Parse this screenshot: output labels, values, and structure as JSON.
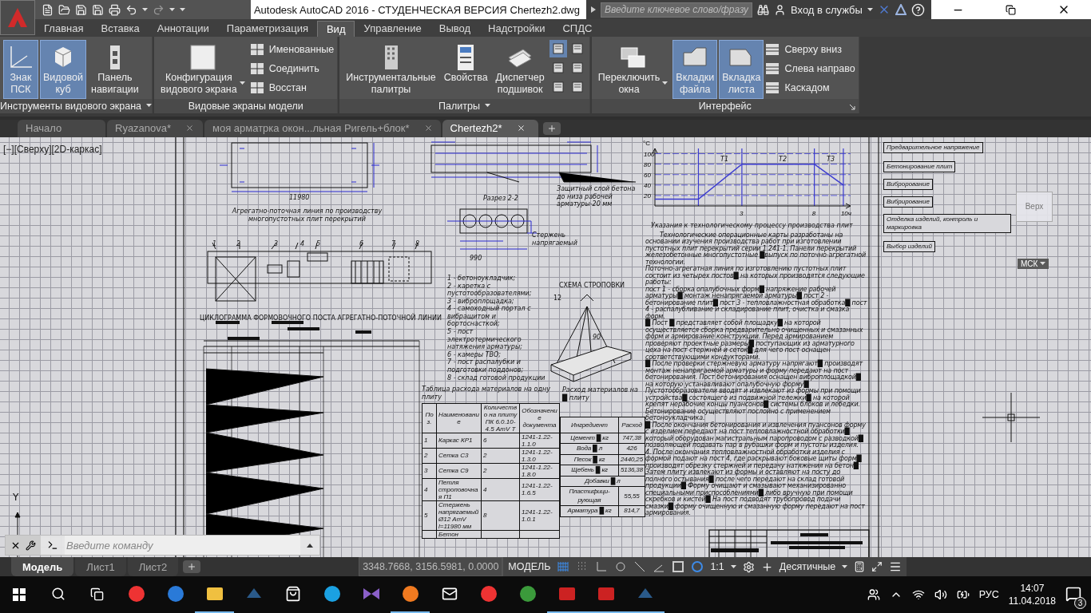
{
  "window": {
    "title": "Autodesk AutoCAD 2016 - СТУДЕНЧЕСКАЯ ВЕРСИЯ",
    "file": "Chertezh2.dwg",
    "search_placeholder": "Введите ключевое слово/фразу",
    "signin": "Вход в службы"
  },
  "ribbon_tabs": [
    {
      "label": "Главная",
      "selected": false
    },
    {
      "label": "Вставка",
      "selected": false
    },
    {
      "label": "Аннотации",
      "selected": false
    },
    {
      "label": "Параметризация",
      "selected": false
    },
    {
      "label": "Вид",
      "selected": true
    },
    {
      "label": "Управление",
      "selected": false
    },
    {
      "label": "Вывод",
      "selected": false
    },
    {
      "label": "Надстройки",
      "selected": false
    },
    {
      "label": "СПДС",
      "selected": false
    }
  ],
  "panels": [
    {
      "title": "Инструменты видового экрана",
      "menu": true,
      "items": [
        {
          "kind": "large",
          "label": "Знак\nПСК",
          "on": true
        },
        {
          "kind": "large",
          "label": "Видовой\nкуб",
          "on": true
        },
        {
          "kind": "large",
          "label": "Панель\nнавигации",
          "on": false
        }
      ]
    },
    {
      "title": "Видовые экраны модели",
      "menu": false,
      "items": [
        {
          "kind": "large",
          "label": "Конфигурация\nвидового экрана",
          "on": false,
          "dropdown": true
        },
        {
          "kind": "small",
          "label": "Именованные"
        },
        {
          "kind": "small",
          "label": "Соединить"
        },
        {
          "kind": "small",
          "label": "Восстан"
        }
      ]
    },
    {
      "title": "Палитры",
      "menu": true,
      "items": [
        {
          "kind": "large",
          "label": "Инструментальные\nпалитры",
          "on": false
        },
        {
          "kind": "large",
          "label": "Свойства",
          "on": false
        },
        {
          "kind": "large",
          "label": "Диспетчер\nподшивок",
          "on": false
        },
        {
          "kind": "icon",
          "on": true
        },
        {
          "kind": "icon",
          "on": false
        },
        {
          "kind": "icon",
          "on": false
        },
        {
          "kind": "icon",
          "on": false
        },
        {
          "kind": "icon",
          "on": false
        },
        {
          "kind": "icon",
          "on": false
        }
      ]
    },
    {
      "title": "Интерфейс",
      "menu": false,
      "launcher": true,
      "items": [
        {
          "kind": "large",
          "label": "Переключить\nокна",
          "on": false,
          "dropdown": true
        },
        {
          "kind": "large",
          "label": "Вкладки\nфайла",
          "on": true
        },
        {
          "kind": "large",
          "label": "Вкладка\nлиста",
          "on": true
        },
        {
          "kind": "small",
          "label": "Сверху вниз"
        },
        {
          "kind": "small",
          "label": "Слева направо"
        },
        {
          "kind": "small",
          "label": "Каскадом"
        }
      ]
    }
  ],
  "doc_tabs": [
    {
      "label": "Начало",
      "selected": false,
      "closable": false
    },
    {
      "label": "Ryazanova*",
      "selected": false,
      "closable": true
    },
    {
      "label": "моя арматрка окон...льная Ригель+блок*",
      "selected": false,
      "closable": true
    },
    {
      "label": "Chertezh2*",
      "selected": true,
      "closable": true
    }
  ],
  "viewport_label": "[−][Сверху][2D-каркас]",
  "annotations": [
    "Агрегатно-поточная линия по производству многопустотных плит перекрытий",
    "ЦИКЛОГРАММА ФОРМОВОЧНОГО ПОСТА АГРЕГАТНО-ПОТОЧНОЙ ЛИНИИ",
    "Разрез 2-2",
    "Защитный слой бетона до низа рабочей арматуры-20 мм",
    "Стержень напрягаемый",
    "СХЕМА СТРОПОВКИ",
    "12",
    "90",
    "11980",
    "990",
    "Указания к технологическому процессу производства плит",
    "Таблица расхода материалов на одну плиту",
    "Расход материалов на █ плиту",
    "Т1",
    "Т2",
    "Т3",
    "1",
    "2",
    "3",
    "4",
    "5",
    "6",
    "7",
    "8"
  ],
  "legend": "1 - бетоноукладчик;\n2 - каретка с пустотообразователями;\n3 - виброплощадка;\n4 - самоходный портал с вибращитом и бортоснасткой;\n5 - пост электротермического натяжения арматуры;\n6 - камеры ТВО;\n7 - пост распалубки и подготовки поддонов;\n8 - склад готовой продукции",
  "paragraphs": [
    "Технологические операционные карты разработаны на основании изучения производства работ при изготовлении пустотных плит перекрытий серии 1.241-1. Панели перекрытий железобетонные многопустотные █выпуск по поточно-агрегатной технологии.",
    "Поточно-агрегатная линия по изготовлению пустотных плит состоит из четырех постов█ на которых производятся следующие работы:",
    "пост 1 - сборка опалубочных форм█ напряжение рабочей арматуры█ монтаж ненапрягаемой арматуры█ пост 2 - бетонирование плит█ пост 3 - тепловлажностная обработка█ пост 4 - распалубливание и складирование плит, очистка и смазка форм.",
    "█ Пост █ представляет собой площадку█ на которой осуществляется сборка предварительно очищенных и смазанных форм и армирование конструкции. Перед армированием проверяют проектные размеры█ поступающих из арматурного цеха на пост стержней и сеток█ для чего пост оснащен соответствующими кондукторами.",
    "█ После проверки стержневую арматуру напрягают█ производят монтаж ненапрягаемой арматуры и форму передают на пост бетонирования. Пост бетонирования оснащен виброплощадкой█ на которую устанавливают опалубочную форму█ Пустотообразователи вводят и извлекают из формы при помощи устройства█ состоящего из подвижной тележки█ на которой крепят нерабочие концы пуансонов█ системы блоков и лебедки. Бетонирование осуществляют послойно с применением бетоноукладчика.",
    "█ После окончания бетонирования и извлечения пуансонов форму с изделием передают на пост тепловлажностной обработки█ который оборудован магистральным паропроводом с разводкой█ позволяющей подавать пар в рубашки форм и пустоты изделия.",
    "4. После окончания тепловлажностной обработки изделия с формой подают на пост 4, где раскрывают боковые щиты форм█ производят обрезку стержней и передачу натяжения на бетон█ Затем плиту извлекают из формы и оставляют на посту до полного остывания█ после чего передают на склад готовой продукции█ Форму очищают и смазывают механизированно специальными приспособлениями█ либо вручную при помощи скребков и кистей█ На пост подводят трубопровод подачи смазки█ форму очищенную и смазанную форму передают на пост армирования."
  ],
  "chart_data": {
    "type": "line",
    "ylabel": "°C",
    "x": [
      -3,
      0,
      3,
      8,
      10
    ],
    "series": [
      {
        "color": "#3b3bd0",
        "values": [
          13,
          13,
          80,
          80,
          40
        ]
      }
    ],
    "xlim": [
      -3,
      10.5
    ],
    "ylim": [
      0,
      110
    ],
    "xticks": [
      3,
      8,
      {
        "value": 10,
        "label": "10ч"
      }
    ],
    "yticks": [
      20,
      40,
      60,
      80,
      100
    ],
    "grid": true,
    "ref_lines": [
      {
        "axis": "x",
        "value": 0
      },
      {
        "axis": "x",
        "value": 3
      },
      {
        "axis": "x",
        "value": 8
      },
      {
        "axis": "x",
        "value": 10
      }
    ]
  },
  "materials_table": {
    "columns": [
      "Поз.",
      "Наименование",
      "Количество на плиту ПК 6.0.10-4.5 АтV Т",
      "Обозначение документа"
    ],
    "rows": [
      [
        "1",
        "Каркас КР1",
        "6",
        "1241-1.22-1.1.0"
      ],
      [
        "2",
        "Сетка С3",
        "2",
        "1241-1.22-1.3.0"
      ],
      [
        "3",
        "Сетка С9",
        "2",
        "1241-1.22-1.8.0"
      ],
      [
        "4",
        "Петля строповочная П1",
        "4",
        "1241-1.22-1.6.5"
      ],
      [
        "5",
        "Стержень напрягаемый Ø12 АтV l=11980 мм",
        "8",
        "1241-1.22-1.0.1"
      ],
      [
        "",
        "Бетон",
        "",
        ""
      ]
    ]
  },
  "mix_table": {
    "columns": [
      "Ингредиент",
      "Расход"
    ],
    "rows": [
      [
        "Цемент █ кг",
        "747,38"
      ],
      [
        "Вода █ л",
        "426"
      ],
      [
        "Песок █ кг",
        "2440,25"
      ],
      [
        "Щебень █ кг",
        "5136,38"
      ],
      [
        {
          "text": "Добавки █ л",
          "colspan": 2
        }
      ],
      [
        "Пластифици- рующая",
        "55,55"
      ],
      [
        "Арматура █ кг",
        "814,7"
      ]
    ]
  },
  "cyclogram_blocks": [
    "Предварительное напряжение",
    "Бетонирование плит",
    "Виброрование",
    "Вибрирование",
    "Отделка изделий, контроль и маркировка",
    "Выбор изделий"
  ],
  "viewcube": {
    "face": "Верх",
    "ucs": "МСК"
  },
  "ucs_label": "Y",
  "command_line": {
    "placeholder": "Введите команду"
  },
  "layout_tabs": [
    {
      "label": "Модель",
      "selected": true
    },
    {
      "label": "Лист1",
      "selected": false
    },
    {
      "label": "Лист2",
      "selected": false
    }
  ],
  "status_bar": {
    "coords": "3348.7668, 3156.5981, 0.0000",
    "space": "МОДЕЛЬ",
    "toggles": [
      {
        "on": true
      },
      {
        "on": false
      },
      {
        "on": false
      },
      {
        "on": false
      },
      {
        "on": false
      },
      {
        "on": false
      },
      {
        "on": false
      },
      {
        "on": true
      }
    ],
    "scale": "1:1",
    "units": "Десятичные"
  },
  "taskbar": {
    "apps": [
      {
        "kind": "yandex-browser",
        "running": false
      },
      {
        "kind": "edge",
        "running": false
      },
      {
        "kind": "explorer",
        "running": true
      },
      {
        "kind": "app",
        "running": false
      },
      {
        "kind": "store",
        "running": false
      },
      {
        "kind": "skype",
        "running": false
      },
      {
        "kind": "vs",
        "running": false
      },
      {
        "kind": "firefox",
        "running": true
      },
      {
        "kind": "mail",
        "running": false
      },
      {
        "kind": "yandex",
        "running": false
      },
      {
        "kind": "chrome",
        "running": false
      },
      {
        "kind": "acrobat",
        "running": true
      },
      {
        "kind": "autocad",
        "running": true
      },
      {
        "kind": "app",
        "running": true
      }
    ],
    "lang": "РУС",
    "time": "14:07",
    "date": "11.04.2018",
    "notifications": "3"
  }
}
